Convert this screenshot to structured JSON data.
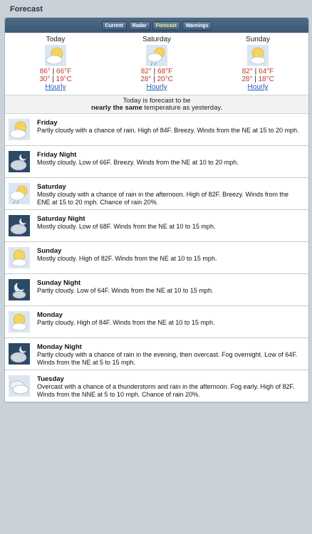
{
  "header": {
    "title": "Forecast"
  },
  "tabs": [
    {
      "label": "Current",
      "active": false
    },
    {
      "label": "Radar",
      "active": false
    },
    {
      "label": "Forecast",
      "active": true
    },
    {
      "label": "Warnings",
      "active": false
    }
  ],
  "summary": [
    {
      "day": "Today",
      "icon": "partly-cloudy-icon",
      "f_hi": "86°",
      "f_lo": "66°F",
      "c_hi": "30°",
      "c_lo": "19°C",
      "link": "Hourly"
    },
    {
      "day": "Saturday",
      "icon": "partly-cloudy-rain-icon",
      "f_hi": "82°",
      "f_lo": "68°F",
      "c_hi": "28°",
      "c_lo": "20°C",
      "link": "Hourly"
    },
    {
      "day": "Sunday",
      "icon": "partly-cloudy-icon",
      "f_hi": "82°",
      "f_lo": "64°F",
      "c_hi": "28°",
      "c_lo": "18°C",
      "link": "Hourly"
    }
  ],
  "comparison": {
    "line1": "Today is forecast to be",
    "emphasis": "nearly the same",
    "line2": " temperature as yesterday."
  },
  "forecast": [
    {
      "title": "Friday",
      "icon": "partly-cloudy-icon",
      "night": false,
      "text": "Partly cloudy with a chance of rain. High of 84F. Breezy. Winds from the NE at 15 to 20 mph."
    },
    {
      "title": "Friday Night",
      "icon": "mostly-cloudy-night-icon",
      "night": true,
      "text": "Mostly cloudy. Low of 66F. Breezy. Winds from the NE at 10 to 20 mph."
    },
    {
      "title": "Saturday",
      "icon": "partly-cloudy-rain-icon",
      "night": false,
      "text": "Mostly cloudy with a chance of rain in the afternoon. High of 82F. Breezy. Winds from the ENE at 15 to 20 mph. Chance of rain 20%."
    },
    {
      "title": "Saturday Night",
      "icon": "mostly-cloudy-night-icon",
      "night": true,
      "text": "Mostly cloudy. Low of 68F. Winds from the NE at 10 to 15 mph."
    },
    {
      "title": "Sunday",
      "icon": "partly-cloudy-icon",
      "night": false,
      "text": "Mostly cloudy. High of 82F. Winds from the NE at 10 to 15 mph."
    },
    {
      "title": "Sunday Night",
      "icon": "partly-cloudy-night-icon",
      "night": true,
      "text": "Partly cloudy. Low of 64F. Winds from the NE at 10 to 15 mph."
    },
    {
      "title": "Monday",
      "icon": "partly-cloudy-icon",
      "night": false,
      "text": "Partly cloudy. High of 84F. Winds from the NE at 10 to 15 mph."
    },
    {
      "title": "Monday Night",
      "icon": "partly-cloudy-night-icon",
      "night": true,
      "text": "Partly cloudy with a chance of rain in the evening, then overcast. Fog overnight. Low of 64F. Winds from the NE at 5 to 15 mph."
    },
    {
      "title": "Tuesday",
      "icon": "overcast-icon",
      "night": false,
      "text": "Overcast with a chance of a thunderstorm and rain in the afternoon. Fog early. High of 82F. Winds from the NNE at 5 to 10 mph. Chance of rain 20%."
    }
  ]
}
